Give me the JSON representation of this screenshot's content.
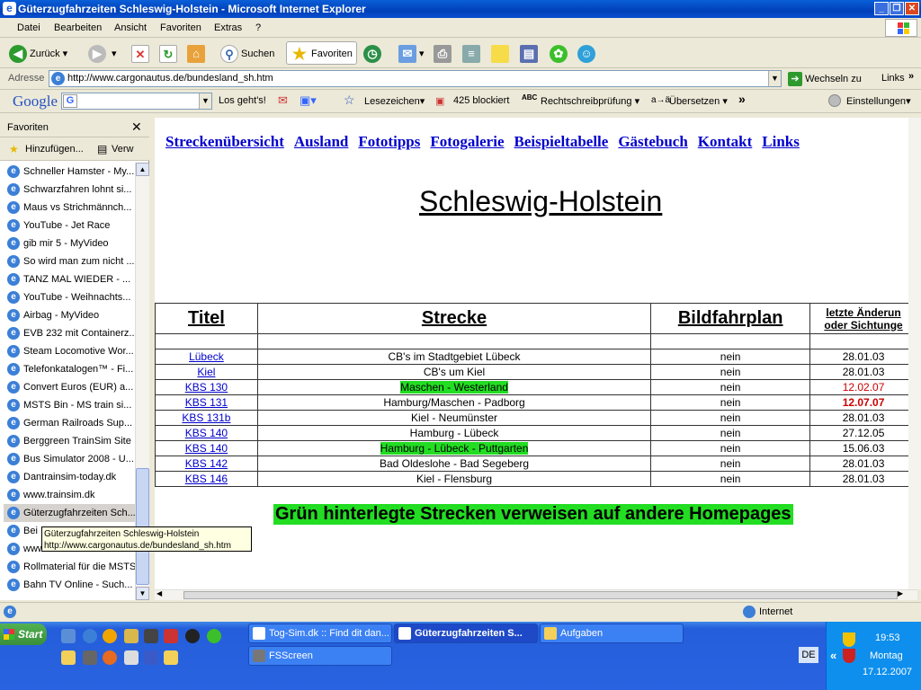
{
  "window": {
    "title": "Güterzugfahrzeiten Schleswig-Holstein - Microsoft Internet Explorer"
  },
  "menu": [
    "Datei",
    "Bearbeiten",
    "Ansicht",
    "Favoriten",
    "Extras",
    "?"
  ],
  "toolbar": {
    "back": "Zurück",
    "search": "Suchen",
    "favorites": "Favoriten"
  },
  "address": {
    "label": "Adresse",
    "url": "http://www.cargonautus.de/bundesland_sh.htm",
    "go": "Wechseln zu",
    "links": "Links"
  },
  "google": {
    "logo": "Google",
    "search_go": "Los geht's!",
    "bookmarks": "Lesezeichen",
    "blocked": "425 blockiert",
    "spellcheck": "Rechtschreibprüfung",
    "translate": "Übersetzen",
    "settings": "Einstellungen"
  },
  "favorites": {
    "title": "Favoriten",
    "add": "Hinzufügen...",
    "organize": "Verw",
    "items": [
      "Schneller Hamster - My...",
      "Schwarzfahren lohnt si...",
      "Maus vs Strichmännch...",
      "YouTube - Jet Race",
      "gib mir 5 - MyVideo",
      "So wird man zum nicht ...",
      "TANZ MAL WIEDER - ...",
      "YouTube - Weihnachts...",
      "Airbag - MyVideo",
      "EVB 232 mit Containerz...",
      "Steam Locomotive Wor...",
      "Telefonkatalogen™ - Fi...",
      "Convert Euros (EUR) a...",
      "MSTS Bin - MS train si...",
      "German Railroads Sup...",
      "Berggreen TrainSim Site",
      "Bus Simulator 2008 - U...",
      "Dantrainsim-today.dk",
      "www.trainsim.dk",
      "Güterzugfahrzeiten Sch...",
      "Bei",
      "www",
      "Rollmaterial für die MSTS",
      "Bahn TV Online - Such..."
    ],
    "tooltip_title": "Güterzugfahrzeiten Schleswig-Holstein",
    "tooltip_url": "http://www.cargonautus.de/bundesland_sh.htm"
  },
  "page": {
    "nav": [
      "Streckenübersicht",
      "Ausland",
      "Fototipps",
      "Fotogalerie",
      "Beispieltabelle",
      "Gästebuch",
      "Kontakt",
      "Links"
    ],
    "heading": "Schleswig-Holstein",
    "table": {
      "headers": [
        "Titel",
        "Strecke",
        "Bildfahrplan"
      ],
      "header_last_1": "letzte Änderun",
      "header_last_2": "oder Sichtunge",
      "rows": [
        {
          "titel": "Lübeck",
          "strecke": "CB's im Stadtgebiet Lübeck",
          "bild": "nein",
          "datum": "28.01.03",
          "green": false,
          "style": ""
        },
        {
          "titel": "Kiel",
          "strecke": "CB's um Kiel",
          "bild": "nein",
          "datum": "28.01.03",
          "green": false,
          "style": ""
        },
        {
          "titel": "KBS 130",
          "strecke": "Maschen - Westerland",
          "bild": "nein",
          "datum": "12.02.07",
          "green": true,
          "style": "red"
        },
        {
          "titel": "KBS 131",
          "strecke": "Hamburg/Maschen - Padborg",
          "bild": "nein",
          "datum": "12.07.07",
          "green": false,
          "style": "redb"
        },
        {
          "titel": "KBS 131b",
          "strecke": "Kiel - Neumünster",
          "bild": "nein",
          "datum": "28.01.03",
          "green": false,
          "style": ""
        },
        {
          "titel": "KBS 140",
          "strecke": "Hamburg - Lübeck",
          "bild": "nein",
          "datum": "27.12.05",
          "green": false,
          "style": ""
        },
        {
          "titel": "KBS 140",
          "strecke": "Hamburg - Lübeck - Puttgarten",
          "bild": "nein",
          "datum": "15.06.03",
          "green": true,
          "style": ""
        },
        {
          "titel": "KBS 142",
          "strecke": "Bad Oldeslohe - Bad Segeberg",
          "bild": "nein",
          "datum": "28.01.03",
          "green": false,
          "style": ""
        },
        {
          "titel": "KBS 146",
          "strecke": "Kiel - Flensburg",
          "bild": "nein",
          "datum": "28.01.03",
          "green": false,
          "style": ""
        }
      ]
    },
    "notice": "Grün hinterlegte Strecken verweisen auf andere Homepages"
  },
  "status": {
    "zone": "Internet"
  },
  "taskbar": {
    "start": "Start",
    "buttons": [
      "Tog-Sim.dk :: Find dit dan...",
      "Güterzugfahrzeiten S...",
      "Aufgaben",
      "FSScreen"
    ],
    "lang": "DE",
    "time": "19:53",
    "day": "Montag",
    "date": "17.12.2007"
  }
}
